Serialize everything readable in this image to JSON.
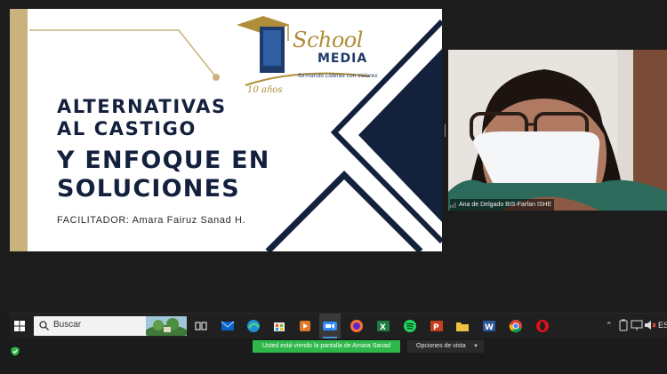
{
  "slide": {
    "logo": {
      "school": "School",
      "media": "MEDIA",
      "years": "10 años",
      "tagline": "formando Líderes con Valores"
    },
    "title_lines": [
      "ALTERNATIVAS",
      "AL CASTIGO",
      "Y ENFOQUE EN",
      "SOLUCIONES"
    ],
    "facilitator": "FACILITADOR: Amara Fairuz Sanad H.",
    "colors": {
      "navy": "#13213d",
      "gold": "#c9b27c"
    }
  },
  "participant": {
    "name": "Ana de Delgado BIS-Farfan ISHE"
  },
  "taskbar": {
    "search_placeholder": "Buscar",
    "apps": [
      "task-view-icon",
      "mail-icon",
      "edge-icon",
      "store-icon",
      "media-player-icon",
      "zoom-icon",
      "firefox-icon",
      "excel-icon",
      "spotify-icon",
      "powerpoint-icon",
      "file-explorer-icon",
      "word-icon",
      "chrome-icon",
      "opera-icon"
    ],
    "tray_label": "ES"
  },
  "share_bar": {
    "notice": "Usted está viendo la pantalla de Amara Sanad",
    "view_options": "Opciones de vista"
  }
}
